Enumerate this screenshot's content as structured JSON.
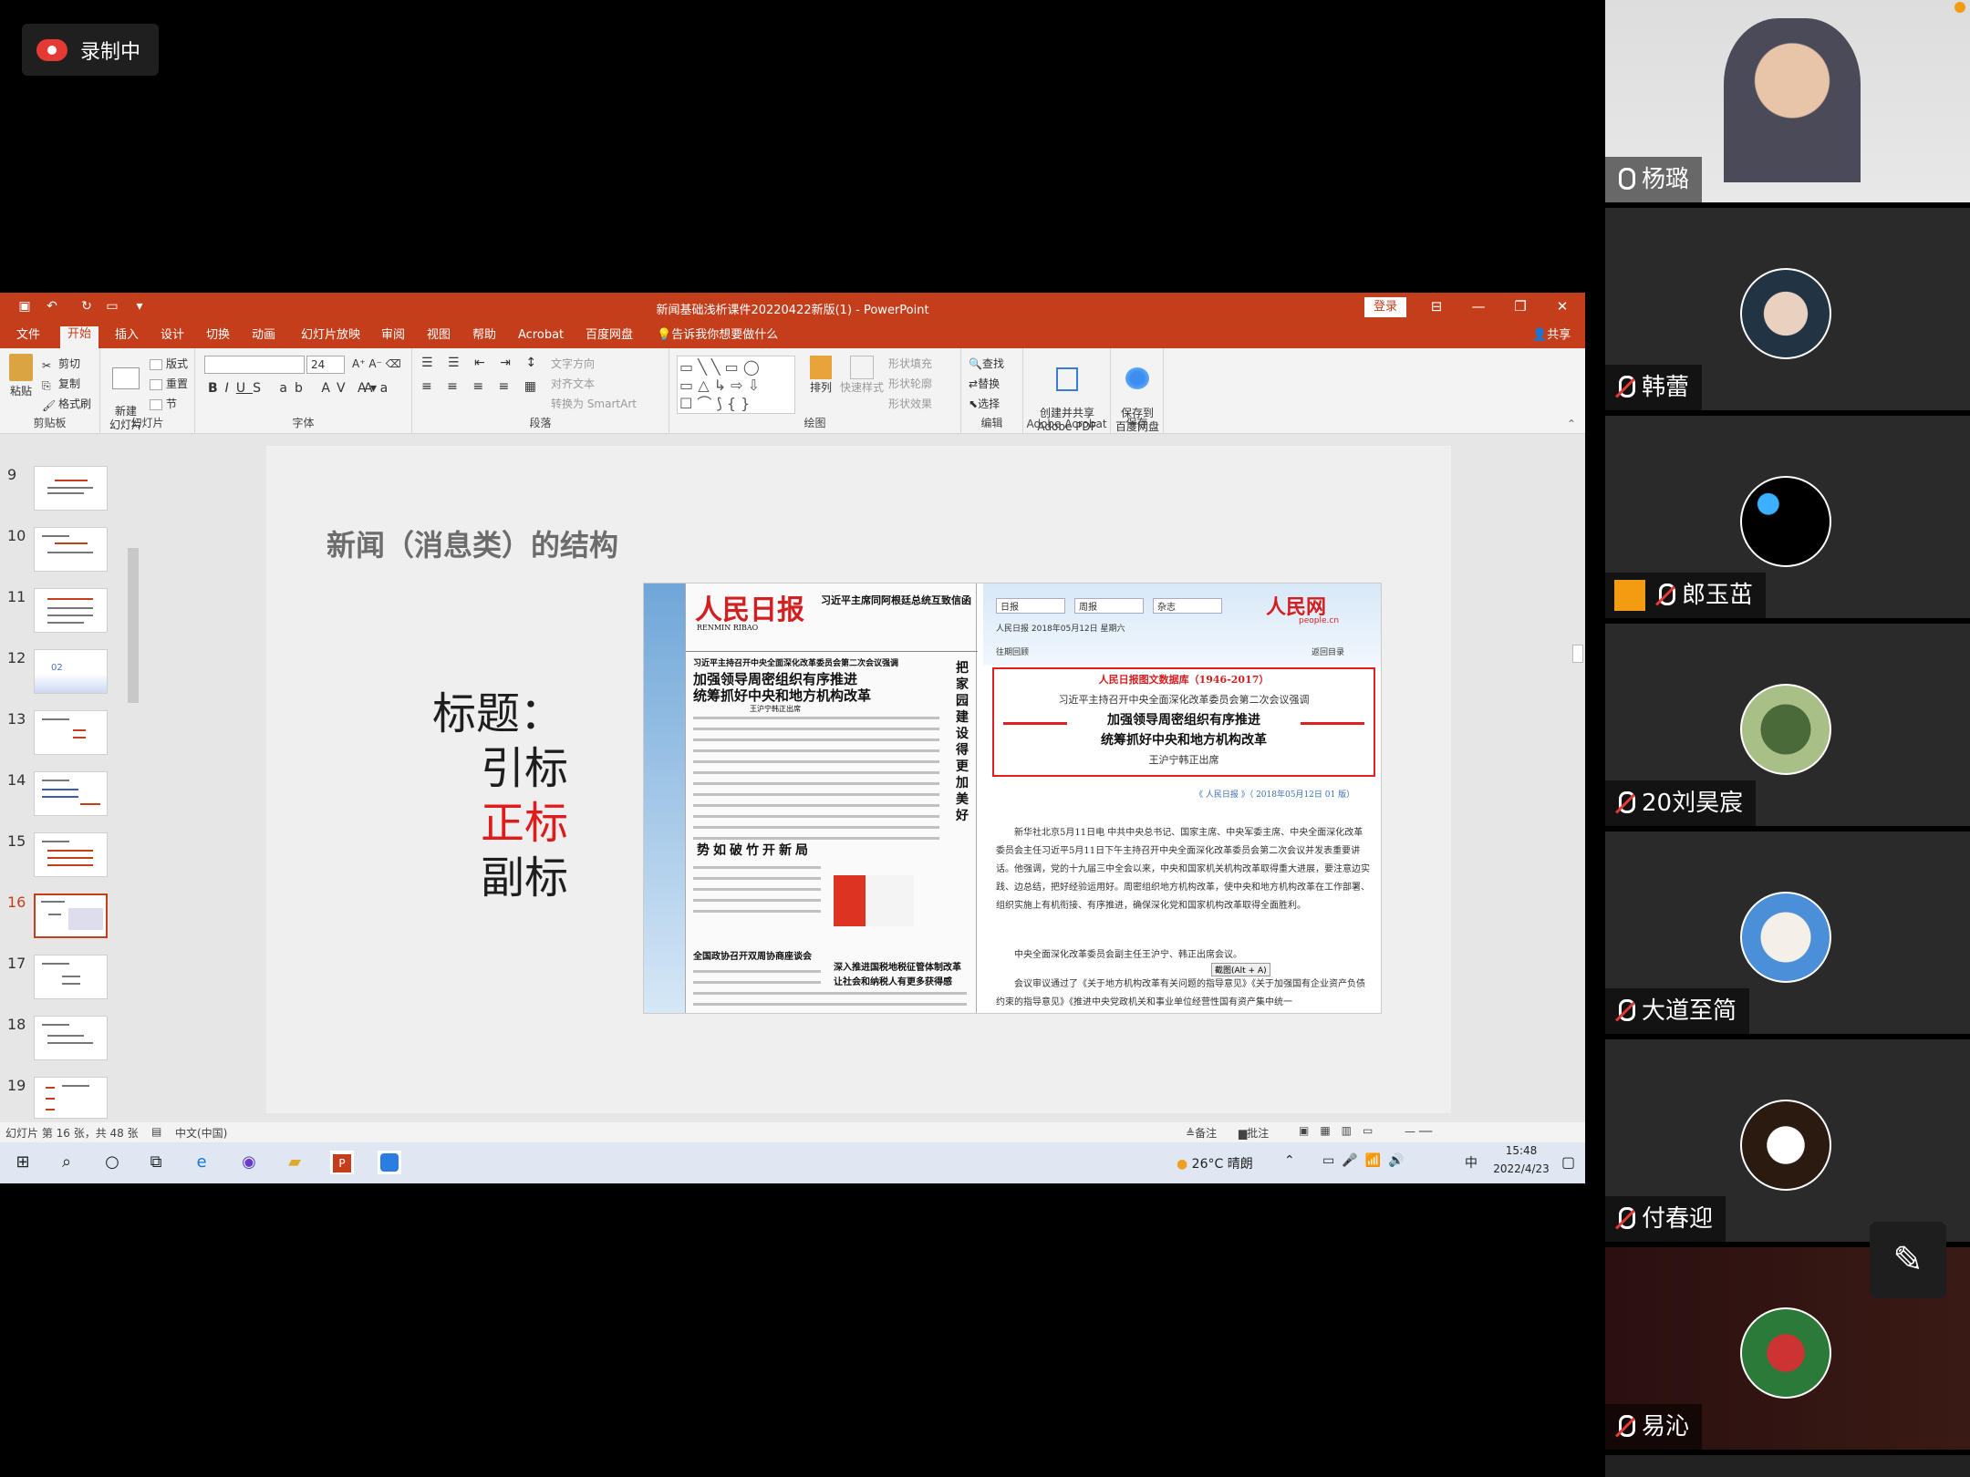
{
  "recording": {
    "label": "录制中"
  },
  "ppt": {
    "window_title": "新闻基础浅析课件20220422新版(1)  -  PowerPoint",
    "login_label": "登录",
    "share_label": "共享",
    "tabs": [
      "文件",
      "开始",
      "插入",
      "设计",
      "切换",
      "动画",
      "幻灯片放映",
      "审阅",
      "视图",
      "帮助",
      "Acrobat",
      "百度网盘"
    ],
    "tell_me": "告诉我你想要做什么",
    "ribbon": {
      "paste": "粘贴",
      "cut": "剪切",
      "copy": "复制",
      "format_painter": "格式刷",
      "clipboard": "剪贴板",
      "new_slide": "新建\n幻灯片",
      "layout": "版式",
      "reset": "重置",
      "section": "节",
      "slides": "幻灯片",
      "font_size": "24",
      "font": "字体",
      "text_direction": "文字方向",
      "align_text": "对齐文本",
      "smartart": "转换为 SmartArt",
      "paragraph": "段落",
      "arrange": "排列",
      "quick_styles": "快速样式",
      "shape_fill": "形状填充",
      "shape_outline": "形状轮廓",
      "shape_effects": "形状效果",
      "drawing": "绘图",
      "find": "查找",
      "replace": "替换",
      "select": "选择",
      "editing": "编辑",
      "create_pdf": "创建并共享\nAdobe PDF",
      "adobe": "Adobe Acrobat",
      "save_baidu": "保存到\n百度网盘",
      "save": "保存"
    },
    "thumbs": [
      {
        "num": "9"
      },
      {
        "num": "10"
      },
      {
        "num": "11"
      },
      {
        "num": "12"
      },
      {
        "num": "13"
      },
      {
        "num": "14"
      },
      {
        "num": "15"
      },
      {
        "num": "16"
      },
      {
        "num": "17"
      },
      {
        "num": "18"
      },
      {
        "num": "19"
      }
    ],
    "slide": {
      "title": "新闻（消息类）的结构",
      "label": "标题：",
      "items": [
        "引标",
        "正标",
        "副标"
      ],
      "highlight_color": "#e01b1b"
    },
    "clip": {
      "paper_name": "人民日报",
      "paper_en": "RENMIN RIBAO",
      "paper_top_headline": "习近平主席同阿根廷总统互致信函",
      "paper_kicker": "习近平主持召开中央全面深化改革委员会第二次会议强调",
      "paper_headline1": "加强领导周密组织有序推进",
      "paper_headline2": "统筹抓好中央和地方机构改革",
      "paper_byline": "王沪宁韩正出席",
      "paper_side": "把家园建设得更加美好",
      "paper_mid1": "势如破竹开新局",
      "paper_mid2": "全国政协召开双周协商座谈会",
      "paper_mid3": "深入推进国税地税征管体制改革",
      "paper_mid4": "让社会和纳税人有更多获得感",
      "web_sel1": "日报",
      "web_sel2": "周报",
      "web_sel3": "杂志",
      "web_logo": "人民网",
      "web_logo_en": "people.cn",
      "web_date": "人民日报 2018年05月12日 星期六",
      "web_back": "返回目录",
      "web_past": "往期回顾",
      "db_title": "人民日报图文数据库（1946-2017）",
      "db_kicker": "习近平主持召开中央全面深化改革委员会第二次会议强调",
      "db_h1": "加强领导周密组织有序推进",
      "db_h2": "统筹抓好中央和地方机构改革",
      "db_byline": "王沪宁韩正出席",
      "db_source": "《 人民日报 》（ 2018年05月12日   01 版）",
      "body1": "新华社北京5月11日电  中共中央总书记、国家主席、中央军委主席、中央全面深化改革委员会主任习近平5月11日下午主持召开中央全面深化改革委员会第二次会议并发表重要讲话。他强调，党的十九届三中全会以来，中央和国家机关机构改革取得重大进展，要注意边实践、边总结，把好经验运用好。周密组织地方机构改革，使中央和地方机构改革在工作部署、组织实施上有机衔接、有序推进，确保深化党和国家机构改革取得全面胜利。",
      "body2": "中央全面深化改革委员会副主任王沪宁、韩正出席会议。",
      "body3": "会议审议通过了《关于地方机构改革有关问题的指导意见》《关于加强国有企业资产负债约束的指导意见》《推进中央党政机关和事业单位经营性国有资产集中统一",
      "tooltip": "截图(Alt + A)"
    },
    "status": {
      "slide_info": "幻灯片 第 16 张，共 48 张",
      "language": "中文(中国)",
      "notes": "备注",
      "comments": "批注"
    },
    "taskbar": {
      "weather": "26°C  晴朗",
      "ime": "中",
      "time": "15:48",
      "date": "2022/4/23"
    }
  },
  "participants": [
    {
      "name": "杨璐",
      "mic": "on"
    },
    {
      "name": "韩蕾",
      "mic": "off"
    },
    {
      "name": "郎玉茁",
      "mic": "off"
    },
    {
      "name": "20刘昊宸",
      "mic": "off"
    },
    {
      "name": "大道至简",
      "mic": "off"
    },
    {
      "name": "付春迎",
      "mic": "off"
    },
    {
      "name": "易沁",
      "mic": "off"
    }
  ],
  "colors": {
    "ppt_accent": "#c43e1c",
    "record_red": "#e53935"
  }
}
